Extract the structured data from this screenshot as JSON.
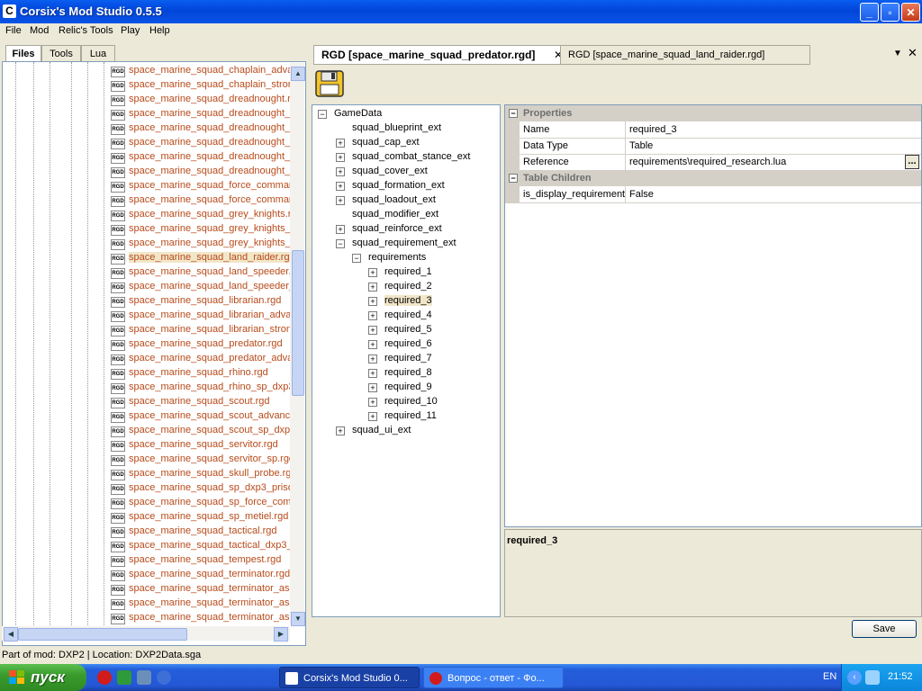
{
  "window": {
    "title": "Corsix's Mod Studio 0.5.5"
  },
  "menu": [
    "File",
    "Mod",
    "Relic's Tools",
    "Play",
    "Help"
  ],
  "left_tabs": [
    "Files",
    "Tools",
    "Lua"
  ],
  "file_icon_text": "RGD",
  "files": [
    "space_marine_squad_chaplain_advan",
    "space_marine_squad_chaplain_strong",
    "space_marine_squad_dreadnought.rg",
    "space_marine_squad_dreadnought_a",
    "space_marine_squad_dreadnought_d",
    "space_marine_squad_dreadnought_h",
    "space_marine_squad_dreadnought_h",
    "space_marine_squad_dreadnought_h",
    "space_marine_squad_force_comman",
    "space_marine_squad_force_comman",
    "space_marine_squad_grey_knights.rg",
    "space_marine_squad_grey_knights_h",
    "space_marine_squad_grey_knights_s",
    "space_marine_squad_land_raider.rgd",
    "space_marine_squad_land_speeder.r",
    "space_marine_squad_land_speeder_",
    "space_marine_squad_librarian.rgd",
    "space_marine_squad_librarian_advan",
    "space_marine_squad_librarian_strong",
    "space_marine_squad_predator.rgd",
    "space_marine_squad_predator_advar",
    "space_marine_squad_rhino.rgd",
    "space_marine_squad_rhino_sp_dxp3.",
    "space_marine_squad_scout.rgd",
    "space_marine_squad_scout_advance",
    "space_marine_squad_scout_sp_dxp3",
    "space_marine_squad_servitor.rgd",
    "space_marine_squad_servitor_sp.rgd",
    "space_marine_squad_skull_probe.rgd",
    "space_marine_squad_sp_dxp3_prisor",
    "space_marine_squad_sp_force_comm",
    "space_marine_squad_sp_metiel.rgd",
    "space_marine_squad_tactical.rgd",
    "space_marine_squad_tactical_dxp3_r",
    "space_marine_squad_tempest.rgd",
    "space_marine_squad_terminator.rgd",
    "space_marine_squad_terminator_ass",
    "space_marine_squad_terminator_ass",
    "space_marine_squad_terminator_ass"
  ],
  "selected_file_index": 13,
  "doc_tabs": [
    {
      "label": "RGD [space_marine_squad_predator.rgd]",
      "active": true
    },
    {
      "label": "RGD [space_marine_squad_land_raider.rgd]",
      "active": false
    }
  ],
  "tree": [
    {
      "label": "GameData",
      "level": 0,
      "exp": "−"
    },
    {
      "label": "squad_blueprint_ext",
      "level": 1,
      "exp": ""
    },
    {
      "label": "squad_cap_ext",
      "level": 1,
      "exp": "+"
    },
    {
      "label": "squad_combat_stance_ext",
      "level": 1,
      "exp": "+"
    },
    {
      "label": "squad_cover_ext",
      "level": 1,
      "exp": "+"
    },
    {
      "label": "squad_formation_ext",
      "level": 1,
      "exp": "+"
    },
    {
      "label": "squad_loadout_ext",
      "level": 1,
      "exp": "+"
    },
    {
      "label": "squad_modifier_ext",
      "level": 1,
      "exp": ""
    },
    {
      "label": "squad_reinforce_ext",
      "level": 1,
      "exp": "+"
    },
    {
      "label": "squad_requirement_ext",
      "level": 1,
      "exp": "−"
    },
    {
      "label": "requirements",
      "level": 2,
      "exp": "−"
    },
    {
      "label": "required_1",
      "level": 3,
      "exp": "+"
    },
    {
      "label": "required_2",
      "level": 3,
      "exp": "+"
    },
    {
      "label": "required_3",
      "level": 3,
      "exp": "+"
    },
    {
      "label": "required_4",
      "level": 3,
      "exp": "+"
    },
    {
      "label": "required_5",
      "level": 3,
      "exp": "+"
    },
    {
      "label": "required_6",
      "level": 3,
      "exp": "+"
    },
    {
      "label": "required_7",
      "level": 3,
      "exp": "+"
    },
    {
      "label": "required_8",
      "level": 3,
      "exp": "+"
    },
    {
      "label": "required_9",
      "level": 3,
      "exp": "+"
    },
    {
      "label": "required_10",
      "level": 3,
      "exp": "+"
    },
    {
      "label": "required_11",
      "level": 3,
      "exp": "+"
    },
    {
      "label": "squad_ui_ext",
      "level": 1,
      "exp": "+"
    }
  ],
  "selected_tree_index": 13,
  "properties": {
    "category1": "Properties",
    "rows1": [
      {
        "name": "Name",
        "value": "required_3"
      },
      {
        "name": "Data Type",
        "value": "Table"
      },
      {
        "name": "Reference",
        "value": "requirements\\required_research.lua"
      }
    ],
    "ellipsis": "...",
    "category2": "Table Children",
    "rows2": [
      {
        "name": "is_display_requirement",
        "value": "False"
      }
    ]
  },
  "description": {
    "title": "required_3"
  },
  "save_label": "Save",
  "status": "Part of mod: DXP2 | Location: DXP2Data.sga",
  "taskbar": {
    "start_label": "пуск",
    "tasks": [
      {
        "label": "Corsix's Mod Studio 0..."
      },
      {
        "label": "Вопрос - ответ - Фо..."
      }
    ],
    "lang": "EN",
    "clock": "21:52"
  },
  "colors": {
    "file_text": "#b84a1a",
    "title_bar": "#0a5ef0",
    "taskbar": "#245edb",
    "start": "#3a9b2c"
  }
}
